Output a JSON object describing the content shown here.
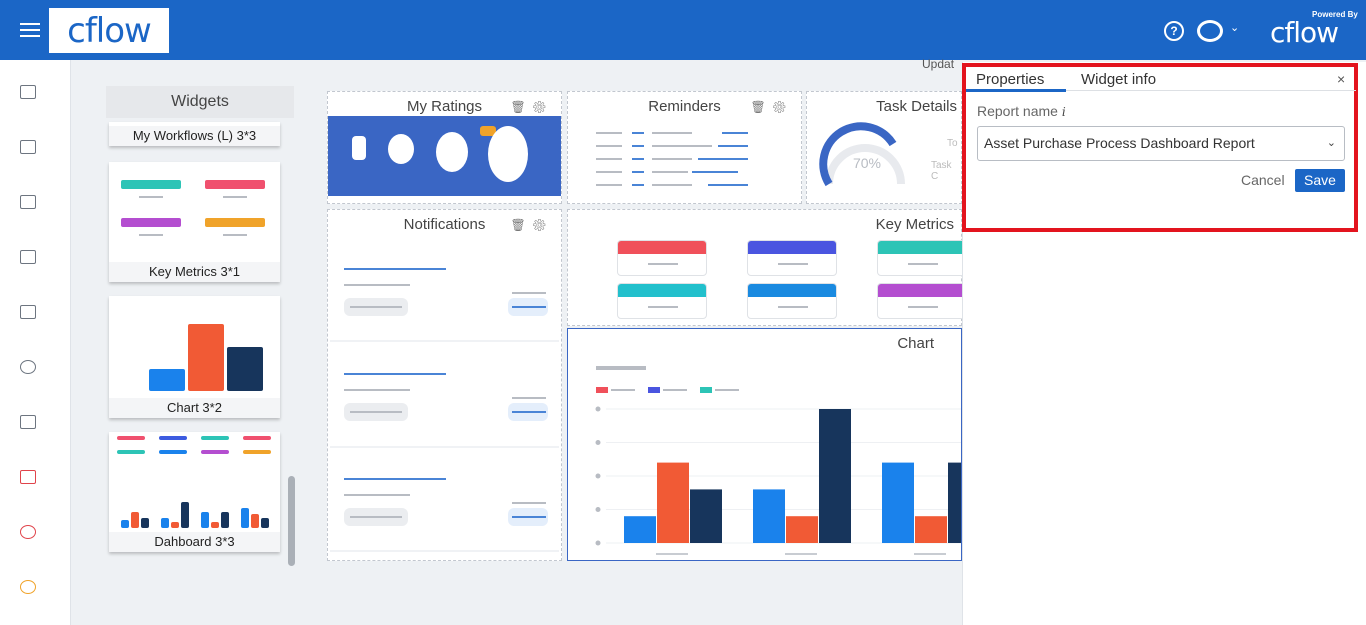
{
  "header": {
    "logo": "cflow",
    "powered_by": "Powered By",
    "brand": "cflow",
    "help_glyph": "?"
  },
  "nav_icons": [
    "home-icon",
    "dashboard-icon",
    "calendar-icon",
    "image-icon",
    "book-icon",
    "history-icon",
    "report-icon",
    "workflow-icon",
    "target-icon",
    "headset-icon"
  ],
  "widgets_panel": {
    "title": "Widgets",
    "items": [
      "My Workflows (L) 3*3",
      "Key Metrics 3*1",
      "Chart 3*2",
      "Dahboard 3*3"
    ]
  },
  "tiles": {
    "my_ratings": "My Ratings",
    "reminders": "Reminders",
    "task_details": "Task Details",
    "task_details_percent": "70%",
    "task_details_labels": [
      "To",
      "Task C"
    ],
    "notifications": "Notifications",
    "key_metrics": "Key Metrics",
    "chart": "Chart",
    "updated_text": "Updat"
  },
  "properties": {
    "tabs": [
      "Properties",
      "Widget info"
    ],
    "close_glyph": "×",
    "report_label": "Report name",
    "info_glyph": "i",
    "report_value": "Asset Purchase Process Dashboard Report",
    "select_caret": "⌄",
    "cancel_label": "Cancel",
    "save_label": "Save"
  },
  "colors": {
    "brand_blue": "#1b66c6",
    "highlight_red": "#e3141e",
    "series": [
      "#1a82ec",
      "#f15a35",
      "#17355c"
    ]
  },
  "chart_data": {
    "type": "bar",
    "categories": [
      "",
      "",
      ""
    ],
    "series": [
      {
        "values": [
          1,
          2,
          3
        ]
      },
      {
        "values": [
          3,
          1,
          1
        ]
      },
      {
        "values": [
          2,
          5,
          3
        ]
      }
    ],
    "ylim": [
      0,
      5
    ]
  }
}
